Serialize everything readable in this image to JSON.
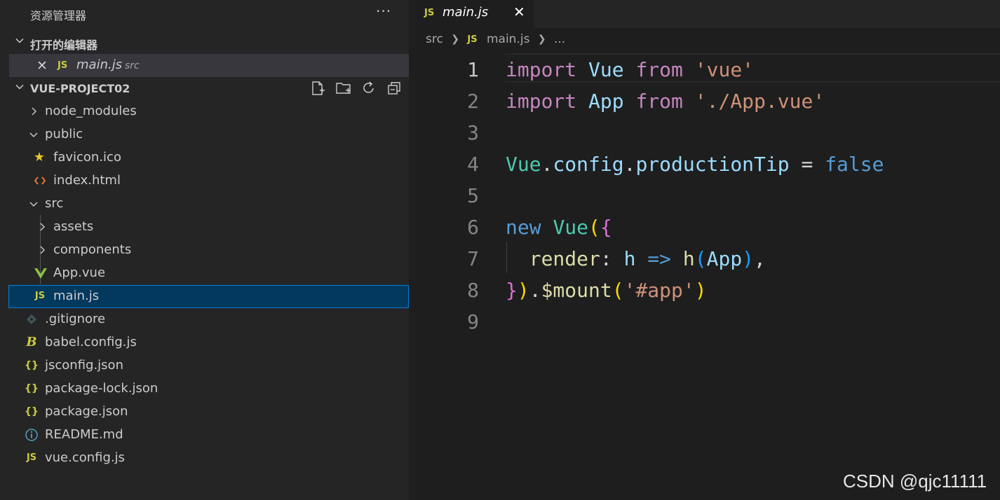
{
  "explorer": {
    "title": "资源管理器",
    "more_label": "···",
    "open_editors": {
      "header": "打开的编辑器",
      "items": [
        {
          "name": "main.js",
          "description": "src",
          "icon": "JS"
        }
      ]
    },
    "project": {
      "header": "VUE-PROJECT02",
      "actions": [
        "new-file-icon",
        "new-folder-icon",
        "refresh-icon",
        "collapse-all-icon"
      ],
      "tree": [
        {
          "label": "node_modules",
          "type": "folder",
          "expanded": false
        },
        {
          "label": "public",
          "type": "folder",
          "expanded": true
        },
        {
          "label": "favicon.ico",
          "type": "file",
          "icon": "star-icon"
        },
        {
          "label": "index.html",
          "type": "file",
          "icon": "html-icon"
        },
        {
          "label": "src",
          "type": "folder",
          "expanded": true
        },
        {
          "label": "assets",
          "type": "folder",
          "expanded": false
        },
        {
          "label": "components",
          "type": "folder",
          "expanded": false
        },
        {
          "label": "App.vue",
          "type": "file",
          "icon": "vue-icon"
        },
        {
          "label": "main.js",
          "type": "file",
          "icon": "JS",
          "selected": true
        },
        {
          "label": ".gitignore",
          "type": "file",
          "icon": "git-icon"
        },
        {
          "label": "babel.config.js",
          "type": "file",
          "icon": "babel-icon"
        },
        {
          "label": "jsconfig.json",
          "type": "file",
          "icon": "{}"
        },
        {
          "label": "package-lock.json",
          "type": "file",
          "icon": "{}"
        },
        {
          "label": "package.json",
          "type": "file",
          "icon": "{}"
        },
        {
          "label": "README.md",
          "type": "file",
          "icon": "info-icon"
        },
        {
          "label": "vue.config.js",
          "type": "file",
          "icon": "JS"
        }
      ]
    }
  },
  "editor": {
    "tab": {
      "name": "main.js",
      "icon": "JS",
      "close": "✕"
    },
    "breadcrumb": {
      "folder": "src",
      "file": "main.js",
      "symbol": "..."
    },
    "line_numbers": [
      "1",
      "2",
      "3",
      "4",
      "5",
      "6",
      "7",
      "8",
      "9"
    ],
    "active_line": "1",
    "code": {
      "l1": {
        "kw": "import",
        "name": "Vue",
        "from": "from",
        "str": "'vue'"
      },
      "l2": {
        "kw": "import",
        "name": "App",
        "from": "from",
        "str": "'./App.vue'"
      },
      "l4": {
        "obj": "Vue",
        "dot1": ".",
        "p1": "config",
        "dot2": ".",
        "p2": "productionTip",
        "op": " = ",
        "val": "false"
      },
      "l6": {
        "kw": "new",
        "cls": "Vue",
        "p": "(",
        "b": "{"
      },
      "l7": {
        "key": "render",
        "colon": ": ",
        "arg": "h",
        "arrow": " => ",
        "fn": "h",
        "p1": "(",
        "app": "App",
        "p2": ")",
        "comma": ","
      },
      "l8": {
        "b": "}",
        "p1": ")",
        "dot": ".",
        "fn": "$mount",
        "p2": "(",
        "str": "'#app'",
        "p3": ")"
      }
    }
  },
  "watermark": "CSDN @qjc11111",
  "colors": {
    "keyword_control": "#c586c0",
    "keyword": "#569cd6",
    "class": "#4ec9b0",
    "string": "#ce9178",
    "property": "#9cdcfe",
    "function": "#dcdcaa",
    "js_icon": "#cbcb41",
    "selection": "#04395e"
  }
}
